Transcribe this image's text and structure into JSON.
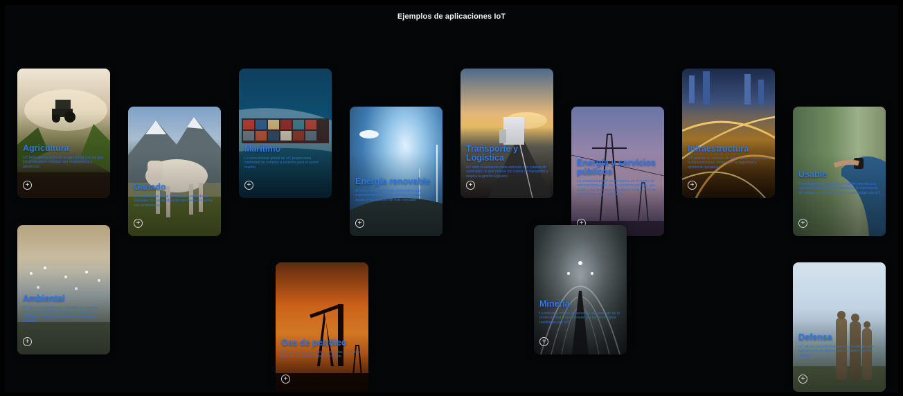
{
  "page": {
    "title": "Ejemplos de aplicaciones IoT"
  },
  "cards": {
    "agricultura": {
      "title": "Agricultura",
      "desc": "IoT tiene aplicaciones en la agricultura con las que los productores mejoran sus rendimientos y ganancias."
    },
    "ganado": {
      "title": "Ganado",
      "desc": "IoT proporciona datos de rastreo y salud de las manadas, lo que ayuda a los rancheros a mejorar sus rendimientos."
    },
    "maritimo": {
      "title": "Marítimo",
      "desc": "La conectividad global de IoT proporciona visibilidad de extremo a extremo para el sector marino."
    },
    "energia_renovable": {
      "title": "Energía renovable",
      "desc": "El sector de las energías renovables está experimentando una transformación masiva. IoT ayuda a la transición de este mercado."
    },
    "transporte": {
      "title": "Transporte y Logística",
      "desc": "IoT está conectando cada vehículo a la cadena de suministro, lo que reduce los costos de transporte y mejora la gestión logística."
    },
    "servicios": {
      "title": "Energía y servicios públicos",
      "desc": "La conectividad IoT se encuentra en el centro de una transformación en los servicios públicos, que ayuda a las empresas a gestionar la demanda de energía con mayor eficiencia."
    },
    "infraestructura": {
      "title": "Infraestructura",
      "desc": "IoT permite la creación de aplicaciones críticas para la infraestructura, mejorando la seguridad y eficiencia operativa."
    },
    "usable": {
      "title": "Usable",
      "desc": "Para dispositivos usables, el satélite permite una comunicación ubicua que garantiza la experiencia de usuario y crecimiento de la conectividad con IoT."
    },
    "ambiental": {
      "title": "Ambiental",
      "desc": "IoT ayuda a proteger los ecosistemas naturales, monitorear la calidad del aire y del agua, y responder a desastres de forma más rápida y eficiente."
    },
    "gas": {
      "title": "Gas de petróleo",
      "desc": "IoT proporciona conexiones confiables y rentables para las compañías de petróleo y gas."
    },
    "mineria": {
      "title": "Minería",
      "desc": "La industria minera se beneficia del aumento de la productividad proporcionado por las tecnologías habilitadas por IoT."
    },
    "defensa": {
      "title": "Defensa",
      "desc": "IoT ofrece conectividad segura y resiliente para aplicaciones de defensa en cualquier lugar del mundo."
    }
  },
  "icons": {
    "expand": "+"
  },
  "colors": {
    "accent": "#2f78e6",
    "background": "#050608"
  }
}
